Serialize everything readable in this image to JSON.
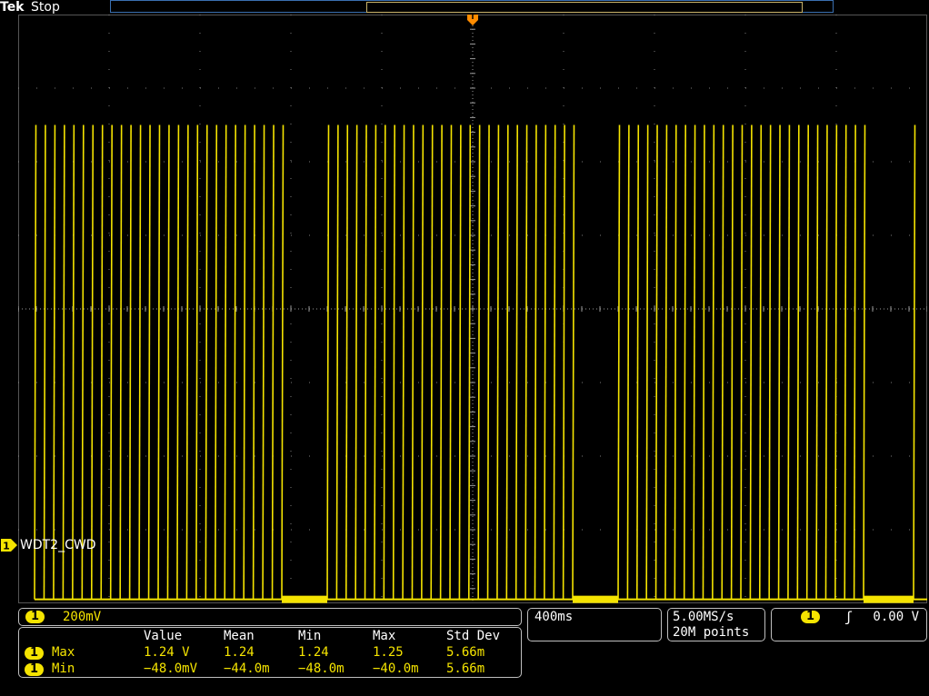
{
  "header": {
    "brand": "Tek",
    "run_state": "Stop"
  },
  "colors": {
    "channel1": "#f5e400",
    "grid": "#9a9a9a",
    "trigger_marker": "#ff8c00",
    "record_bar": "#3a6fb0"
  },
  "waveform": {
    "channel_number": "1",
    "label": "WDT2_CWD",
    "high_level_V": 1.24,
    "low_level_V": -0.048,
    "vertical_scale_V_per_div": 0.2,
    "time_per_div_s": 0.4,
    "bursts": [
      {
        "start_div": 0.18,
        "end_div": 2.9,
        "pulses": 27
      },
      {
        "start_div": 3.4,
        "end_div": 6.1,
        "pulses": 27
      },
      {
        "start_div": 6.6,
        "end_div": 9.3,
        "pulses": 27
      },
      {
        "start_div": 9.85,
        "end_div": 10.0,
        "pulses": 1
      }
    ]
  },
  "channel_box": {
    "badge": "1",
    "scale": "200mV"
  },
  "measurements": {
    "headers": [
      "Value",
      "Mean",
      "Min",
      "Max",
      "Std Dev"
    ],
    "rows": [
      {
        "badge": "1",
        "name": "Max",
        "values": [
          "1.24 V",
          "1.24",
          "1.24",
          "1.25",
          "5.66m"
        ]
      },
      {
        "badge": "1",
        "name": "Min",
        "values": [
          "−48.0mV",
          "−44.0m",
          "−48.0m",
          "−40.0m",
          "5.66m"
        ]
      }
    ]
  },
  "timebase": {
    "scale": "400ms"
  },
  "acquisition": {
    "sample_rate": "5.00MS/s",
    "record_length": "20M points"
  },
  "trigger": {
    "badge": "1",
    "slope_icon": "rising-edge-icon",
    "slope_glyph": "ʃ",
    "level": "0.00 V"
  }
}
